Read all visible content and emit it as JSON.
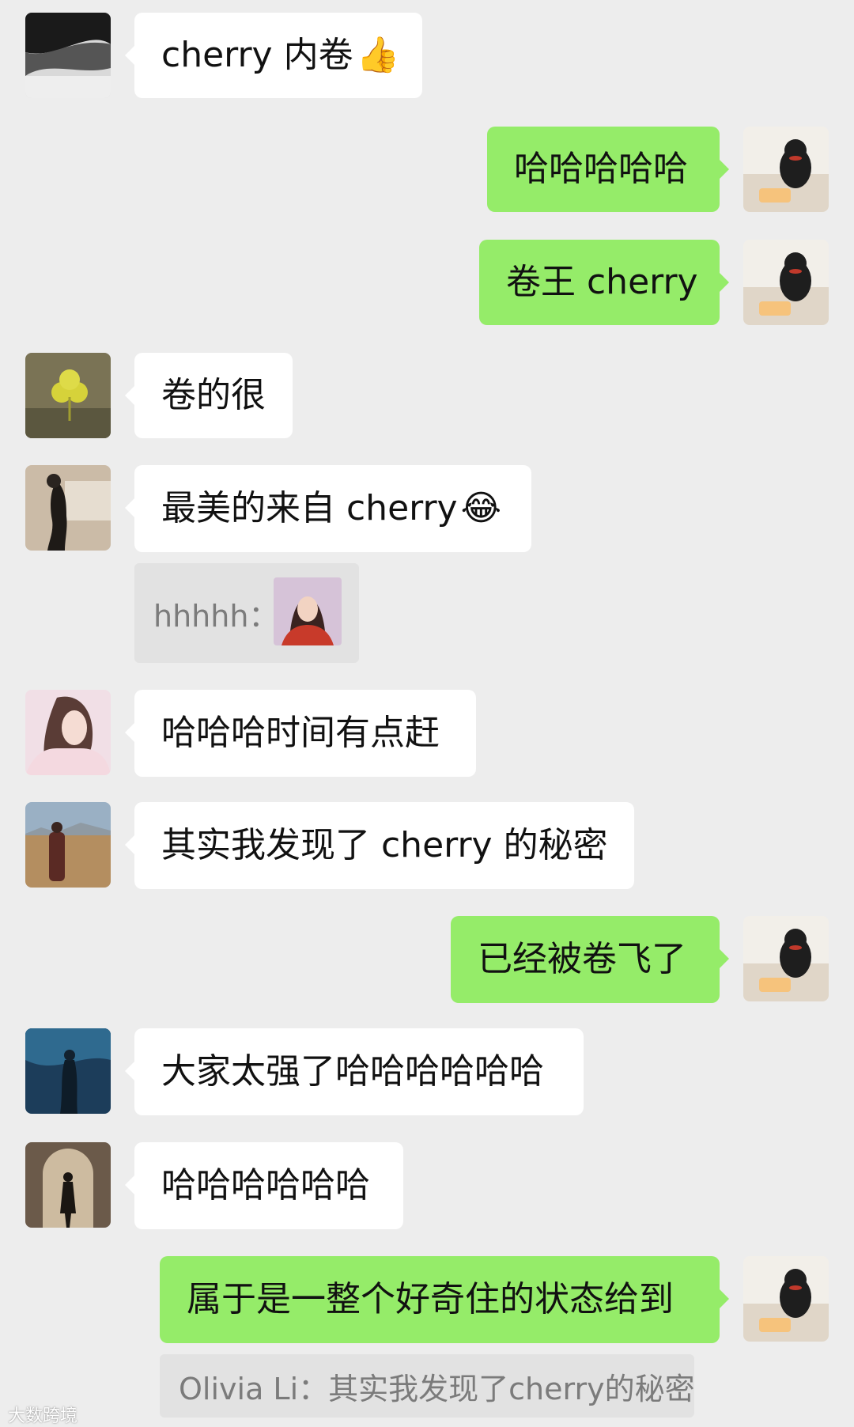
{
  "messages": [
    {
      "text": "cherry 内卷",
      "emoji": "👍"
    },
    {
      "text": "哈哈哈哈哈"
    },
    {
      "text": "卷王 cherry"
    },
    {
      "text": "卷的很"
    },
    {
      "text": "最美的来自 cherry",
      "emoji": "😂"
    },
    {
      "text": "hhhhh："
    },
    {
      "text": "哈哈哈时间有点赶"
    },
    {
      "text": "其实我发现了 cherry 的秘密"
    },
    {
      "text": "已经被卷飞了"
    },
    {
      "text": "大家太强了哈哈哈哈哈哈"
    },
    {
      "text": "哈哈哈哈哈哈"
    },
    {
      "text": "属于是一整个好奇住的状态给到"
    },
    {
      "text": "Olivia Li：其实我发现了cherry的秘密"
    }
  ],
  "watermark": "大数跨境",
  "colors": {
    "background": "#ededed",
    "incoming_bubble": "#ffffff",
    "outgoing_bubble": "#95ec69",
    "quote": "#e2e2e2"
  }
}
